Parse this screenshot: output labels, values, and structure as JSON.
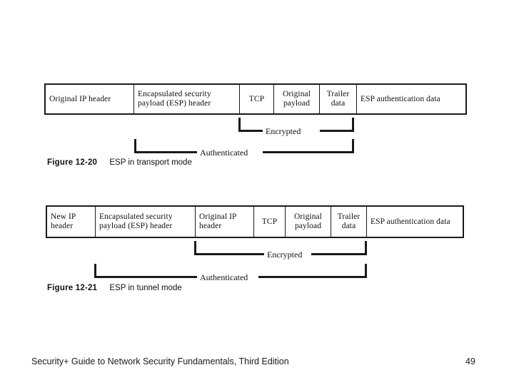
{
  "slide": {
    "background_color": "#ffffff",
    "line_color": "#1a1a1a"
  },
  "figures": [
    {
      "id": "figure-12-20",
      "number": "Figure 12-20",
      "title": "ESP in transport mode",
      "cells": [
        {
          "label": "Original IP header",
          "align": "left"
        },
        {
          "label": "Encapsulated security payload (ESP) header",
          "align": "left"
        },
        {
          "label": "TCP",
          "align": "center"
        },
        {
          "label": "Original payload",
          "align": "center"
        },
        {
          "label": "Trailer data",
          "align": "center"
        },
        {
          "label": "ESP authentication data",
          "align": "left"
        }
      ],
      "brackets": [
        {
          "label": "Encrypted"
        },
        {
          "label": "Authenticated"
        }
      ]
    },
    {
      "id": "figure-12-21",
      "number": "Figure 12-21",
      "title": "ESP in tunnel mode",
      "cells": [
        {
          "label": "New IP header",
          "align": "left"
        },
        {
          "label": "Encapsulated security payload (ESP) header",
          "align": "left"
        },
        {
          "label": "Original IP header",
          "align": "left"
        },
        {
          "label": "TCP",
          "align": "center"
        },
        {
          "label": "Original payload",
          "align": "center"
        },
        {
          "label": "Trailer data",
          "align": "center"
        },
        {
          "label": "ESP authentication data",
          "align": "left"
        }
      ],
      "brackets": [
        {
          "label": "Encrypted"
        },
        {
          "label": "Authenticated"
        }
      ]
    }
  ],
  "footer": {
    "text": "Security+ Guide to Network Security Fundamentals, Third Edition",
    "page_number": "49"
  }
}
